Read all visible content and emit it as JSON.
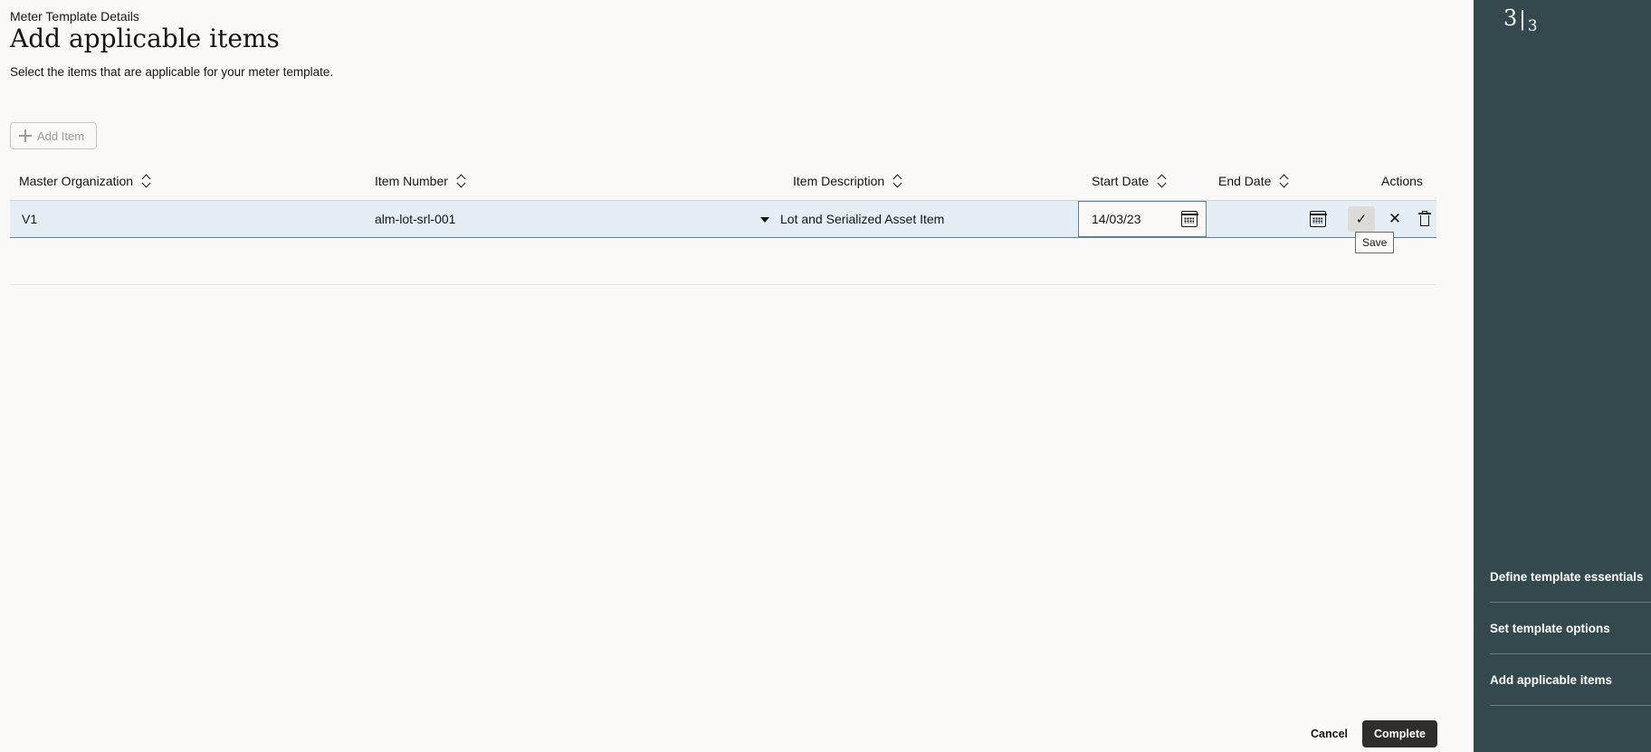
{
  "header": {
    "breadcrumb": "Meter Template Details",
    "title": "Add applicable items",
    "subtitle": "Select the items that are applicable for your meter template."
  },
  "toolbar": {
    "add_item_label": "Add Item"
  },
  "table": {
    "columns": [
      {
        "label": "Master Organization"
      },
      {
        "label": "Item Number"
      },
      {
        "label": "Item Description"
      },
      {
        "label": "Start Date"
      },
      {
        "label": "End Date"
      },
      {
        "label": "Actions"
      }
    ],
    "rows": [
      {
        "master_organization": "V1",
        "item_number": "alm-lot-srl-001",
        "item_description": "Lot and Serialized Asset Item",
        "start_date": "14/03/23",
        "end_date": ""
      }
    ]
  },
  "actions": {
    "save_glyph": "✓",
    "cancel_glyph": "✕",
    "save_tooltip": "Save"
  },
  "footer": {
    "cancel_label": "Cancel",
    "complete_label": "Complete"
  },
  "sidebar": {
    "current_step": "3",
    "total_steps": "3",
    "separator": "|",
    "steps": [
      {
        "label": "Define template essentials"
      },
      {
        "label": "Set template options"
      },
      {
        "label": "Add applicable items"
      }
    ]
  },
  "colors": {
    "sidebar_bg": "#34494d",
    "row_selected_bg": "#e6eef5",
    "primary_button_bg": "#312d2a"
  }
}
